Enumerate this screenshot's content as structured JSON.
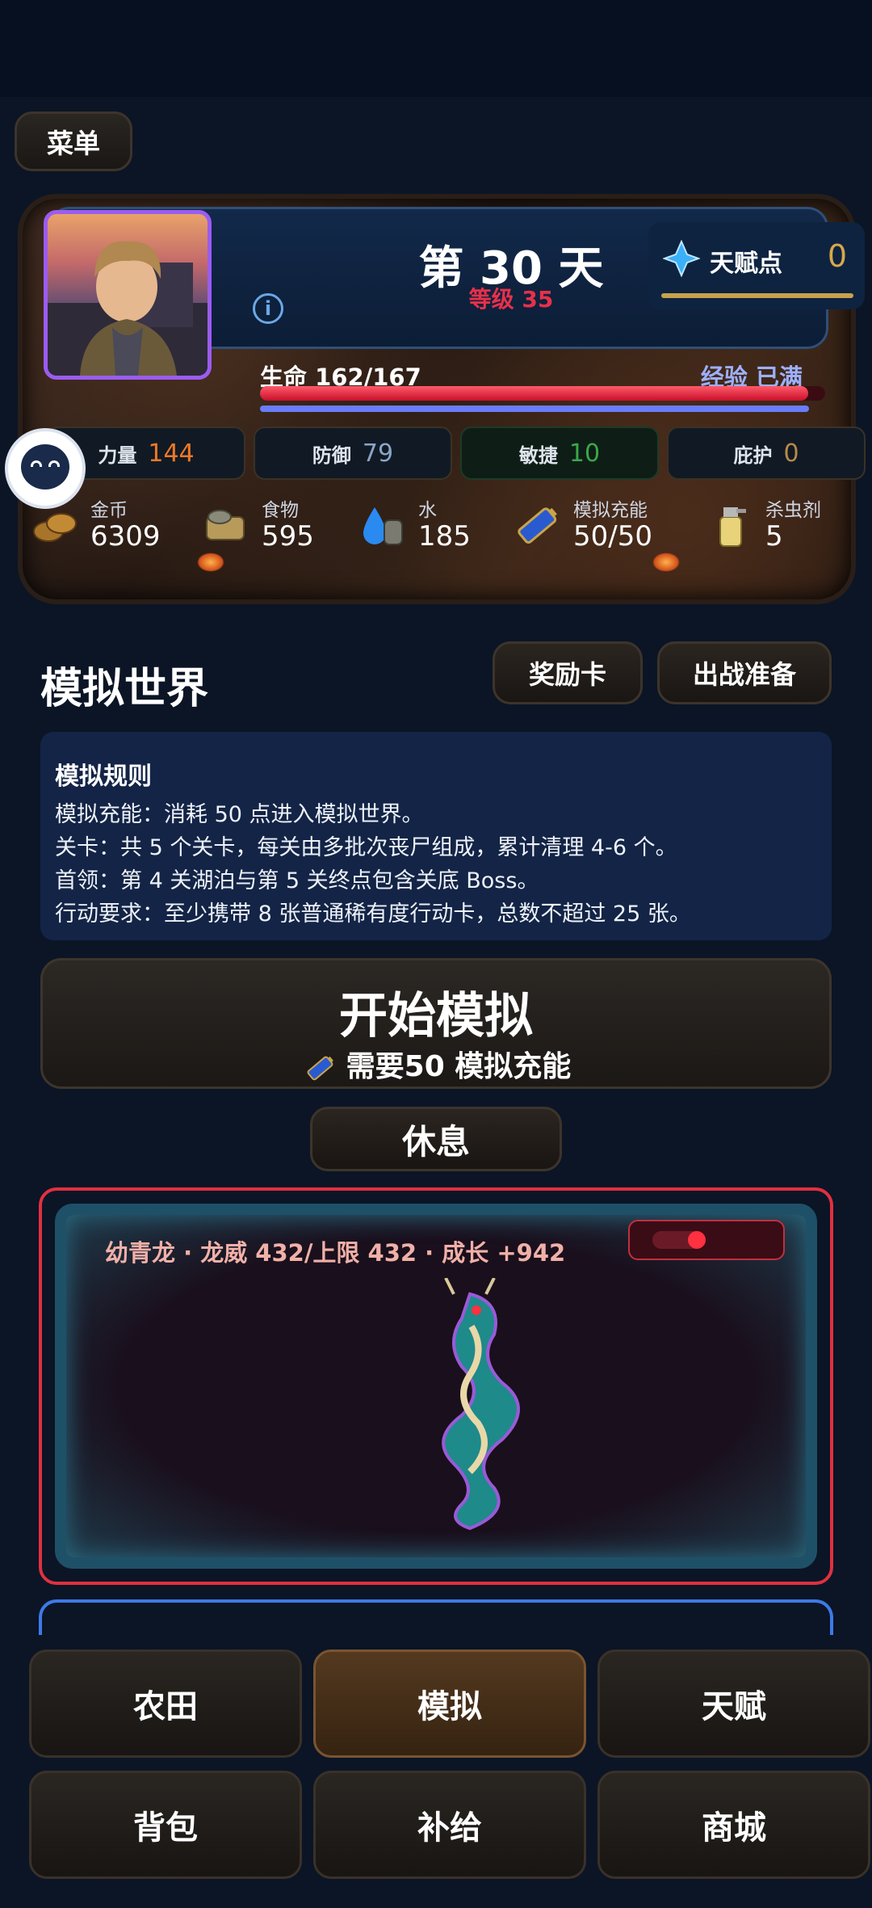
{
  "menu": {
    "label": "菜单"
  },
  "status": {
    "day": "第 30 天",
    "level": "等级 35",
    "talent": {
      "label": "天赋点",
      "value": "0"
    },
    "hp": {
      "label": "生命 162/167",
      "current": 162,
      "max": 167
    },
    "xp": {
      "label": "经验 已满",
      "fill": 1.0
    },
    "stats": [
      {
        "label": "力量",
        "value": "144",
        "color": "#f07828"
      },
      {
        "label": "防御",
        "value": "79",
        "color": "#8aa6c8"
      },
      {
        "label": "敏捷",
        "value": "10",
        "color": "#3aa84a"
      },
      {
        "label": "庇护",
        "value": "0",
        "color": "#b88a4a"
      }
    ],
    "resources": [
      {
        "label": "金币",
        "value": "6309",
        "icon": "coins-icon"
      },
      {
        "label": "食物",
        "value": "595",
        "icon": "food-icon"
      },
      {
        "label": "水",
        "value": "185",
        "icon": "water-icon"
      },
      {
        "label": "模拟充能",
        "value": "50/50",
        "icon": "battery-icon"
      },
      {
        "label": "杀虫剂",
        "value": "5",
        "icon": "spray-icon"
      }
    ]
  },
  "simulation": {
    "title": "模拟世界",
    "reward_btn": "奖励卡",
    "prepare_btn": "出战准备",
    "rules_title": "模拟规则",
    "rules": [
      "模拟充能：消耗 50 点进入模拟世界。",
      "关卡：共 5 个关卡，每关由多批次丧尸组成，累计清理 4-6 个。",
      "首领：第 4 关湖泊与第 5 关终点包含关底 Boss。",
      "行动要求：至少携带 8 张普通稀有度行动卡，总数不超过 25 张。"
    ],
    "start": {
      "title": "开始模拟",
      "sub": "需要50 模拟充能"
    },
    "rest": "休息"
  },
  "pet": {
    "info": "幼青龙 · 龙威 432/上限 432 · 成长 +942",
    "toggle_on": true
  },
  "nav": [
    "农田",
    "模拟",
    "天赋",
    "背包",
    "补给",
    "商城"
  ],
  "nav_active": "模拟",
  "colors": {
    "accent_red": "#e03040",
    "accent_blue": "#3d7ae8",
    "gold": "#d8a84a"
  }
}
